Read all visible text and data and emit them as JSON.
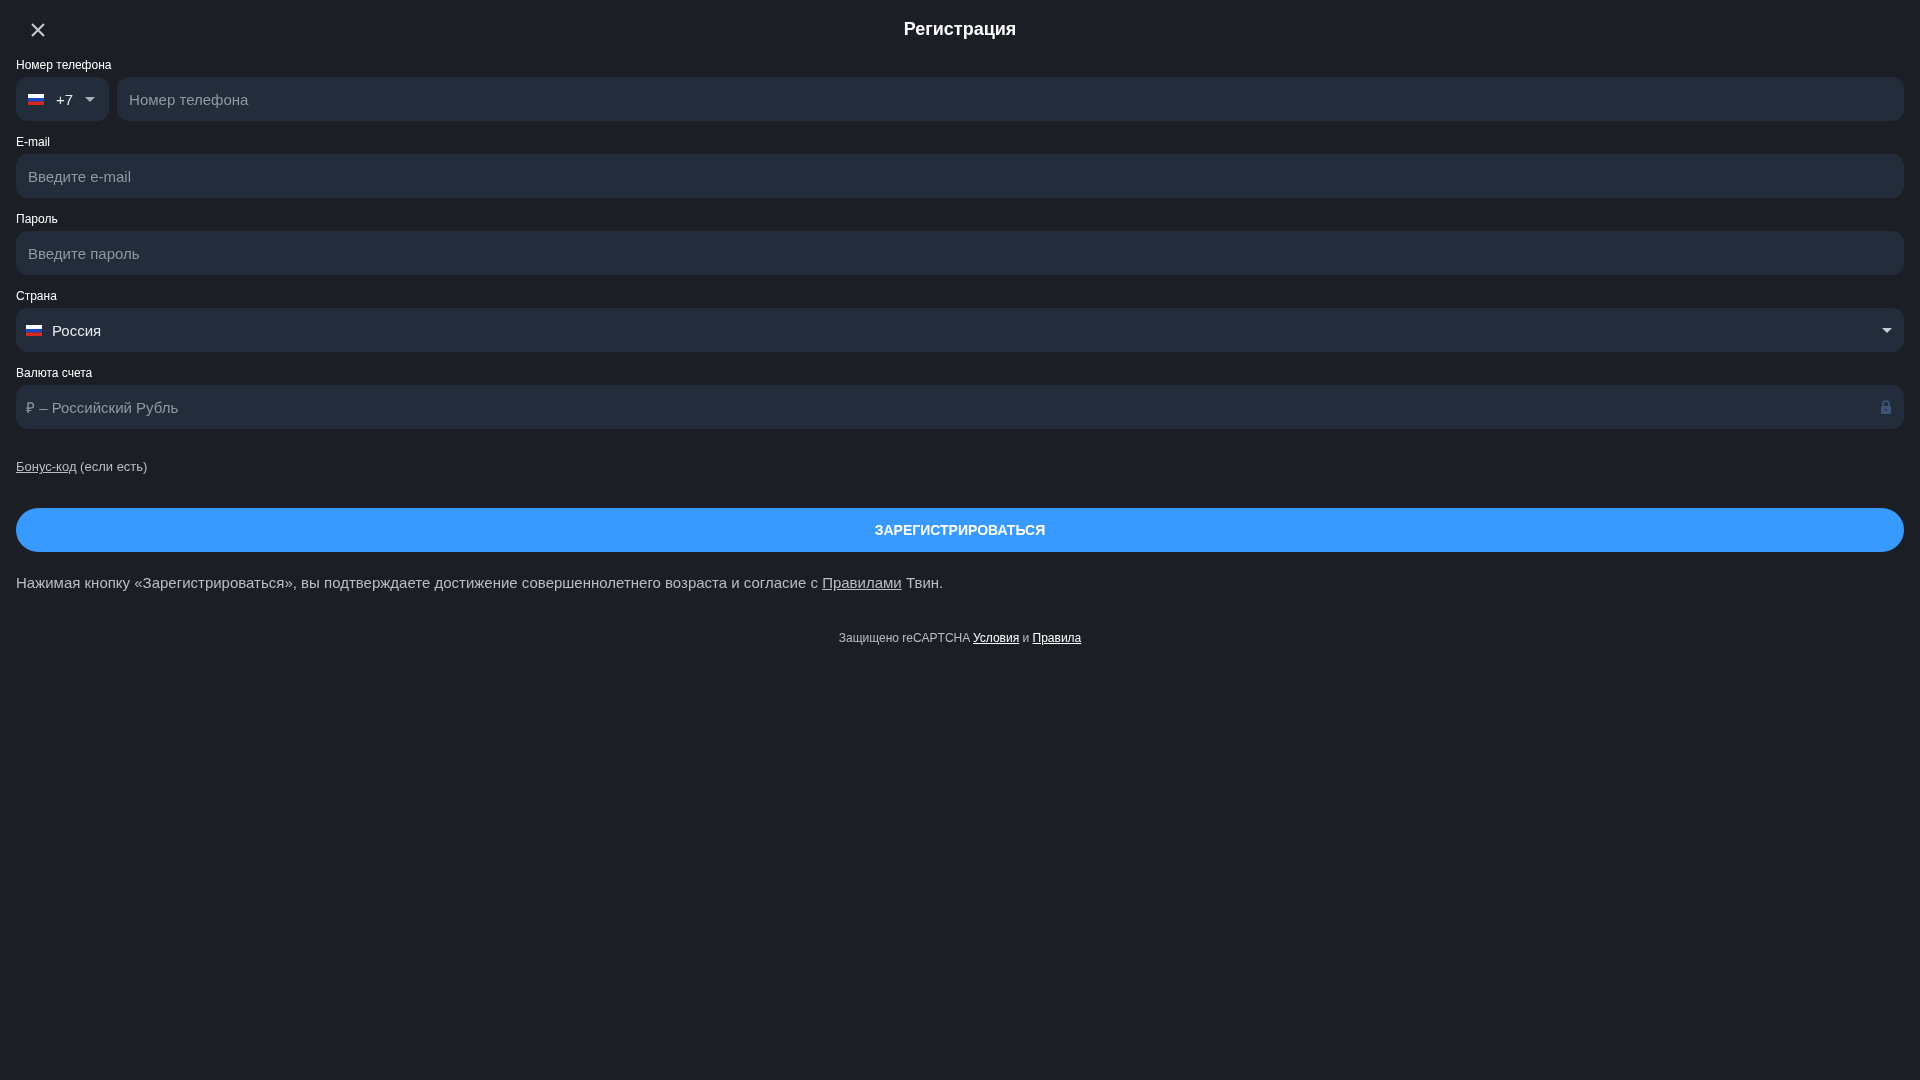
{
  "header": {
    "title": "Регистрация"
  },
  "fields": [
    {
      "kind": "phone",
      "label": "Номер телефона",
      "code": "+7",
      "placeholder": "Номер телефона"
    },
    {
      "kind": "text",
      "label": "E-mail",
      "placeholder": "Введите e-mail"
    },
    {
      "kind": "password",
      "label": "Пароль",
      "placeholder": "Введите пароль"
    },
    {
      "kind": "select",
      "label": "Страна",
      "value": "Россия"
    },
    {
      "kind": "locked",
      "label": "Валюта счета",
      "value": "₽ – Российский Рубль"
    }
  ],
  "bonus": {
    "link": "Бонус-код",
    "rest": "(если есть)"
  },
  "submit": "ЗАРЕГИСТРИРОВАТЬСЯ",
  "disclaimer": {
    "before": "Нажимая кнопку «Зарегистрироваться», вы подтверждаете достижение совершеннолетнего возраста и согласие с",
    "link": "Правилами",
    "after": "Твин."
  },
  "recaptcha": {
    "text": "Защищено reCAPTCHA",
    "link1": "Условия",
    "joiner": "и",
    "link2": "Правила"
  }
}
